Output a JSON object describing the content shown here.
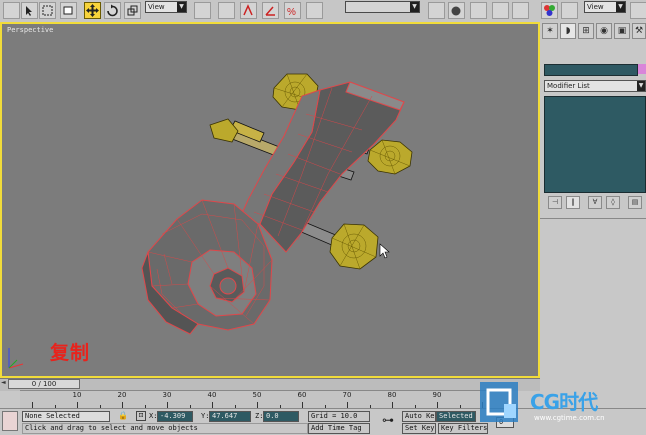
{
  "toolbar": {
    "view_dropdown_1": "View",
    "named_selection": "",
    "view_dropdown_2": "View",
    "select_move_active": true
  },
  "viewport": {
    "label": "Perspective",
    "caption": "复制",
    "border_color": "#f1dc3a"
  },
  "command_panel": {
    "object_name": "",
    "object_color": "#d985d9",
    "modifier_list": "Modifier List"
  },
  "timeslider": {
    "frame": "0 / 100",
    "ticks": [
      "10",
      "20",
      "30",
      "40",
      "50",
      "60",
      "70",
      "80",
      "90"
    ]
  },
  "status": {
    "selection": "None Selected",
    "prompt": "Click and drag to select and move objects",
    "x_label": "X:",
    "x_value": "-4.309",
    "y_label": "Y:",
    "y_value": "47.647",
    "z_label": "Z:",
    "z_value": "0.0",
    "grid": "Grid = 10.0",
    "add_time_tag": "Add Time Tag",
    "auto_key": "Auto Key",
    "selected": "Selected",
    "set_key": "Set Key",
    "key_filters": "Key Filters...",
    "frame_field": "0"
  },
  "watermark": {
    "brand": "CG时代",
    "url": "www.cgtime.com.cn"
  }
}
